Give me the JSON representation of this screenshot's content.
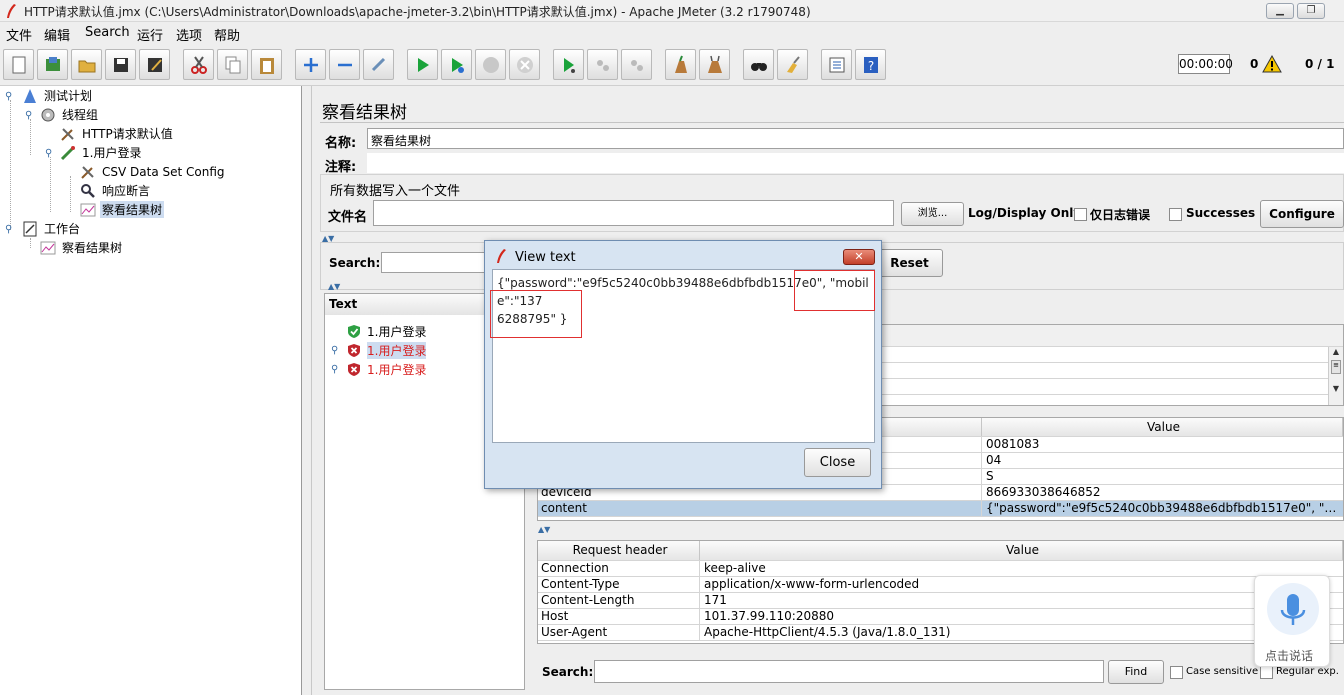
{
  "window": {
    "title": "HTTP请求默认值.jmx (C:\\Users\\Administrator\\Downloads\\apache-jmeter-3.2\\bin\\HTTP请求默认值.jmx) - Apache JMeter (3.2 r1790748)",
    "minimize": "▁",
    "maximize": "❐",
    "close": "✕"
  },
  "menu": [
    "文件",
    "编辑",
    "Search",
    "运行",
    "选项",
    "帮助"
  ],
  "status": {
    "timer": "00:00:00",
    "warnings": "0",
    "threads": "0 / 1"
  },
  "tree": {
    "nodes": [
      {
        "label": "测试计划",
        "icon": "test-plan-icon"
      },
      {
        "label": "线程组",
        "icon": "thread-group-icon"
      },
      {
        "label": "HTTP请求默认值",
        "icon": "config-tool-icon"
      },
      {
        "label": "1.用户登录",
        "icon": "sampler-icon"
      },
      {
        "label": "CSV Data Set Config",
        "icon": "config-tool-icon"
      },
      {
        "label": "响应断言",
        "icon": "assertion-icon"
      },
      {
        "label": "察看结果树",
        "icon": "listener-icon"
      },
      {
        "label": "工作台",
        "icon": "workbench-icon"
      },
      {
        "label": "察看结果树",
        "icon": "listener-icon"
      }
    ]
  },
  "panel": {
    "title": "察看结果树",
    "name_label": "名称:",
    "name_value": "察看结果树",
    "comment_label": "注释:",
    "file_section": "所有数据写入一个文件",
    "filename_label": "文件名",
    "browse": "浏览...",
    "log_display": "Log/Display Only:",
    "errors_only": "仅日志错误",
    "successes": "Successes",
    "configure": "Configure",
    "search_label": "Search:",
    "reset": "Reset",
    "text_header": "Text",
    "results": [
      {
        "label": "1.用户登录",
        "status": "success"
      },
      {
        "label": "1.用户登录",
        "status": "fail"
      },
      {
        "label": "1.用户登录",
        "status": "fail"
      }
    ],
    "params_header_value": "Value",
    "params": [
      {
        "name": "",
        "value": "0081083"
      },
      {
        "name": "",
        "value": "04"
      },
      {
        "name": "",
        "value": "S"
      },
      {
        "name": "deviceId",
        "value": "866933038646852"
      },
      {
        "name": "content",
        "value": "{\"password\":\"e9f5c5240c0bb39488e6dbfbdb1517e0\", \"mobile\":..."
      }
    ],
    "req_header_col": "Request header",
    "req_value_col": "Value",
    "req_headers": [
      {
        "name": "Connection",
        "value": "keep-alive"
      },
      {
        "name": "Content-Type",
        "value": "application/x-www-form-urlencoded"
      },
      {
        "name": "Content-Length",
        "value": "171"
      },
      {
        "name": "Host",
        "value": "101.37.99.110:20880"
      },
      {
        "name": "User-Agent",
        "value": "Apache-HttpClient/4.5.3 (Java/1.8.0_131)"
      }
    ],
    "bottom_search_label": "Search:",
    "find": "Find",
    "case_sensitive": "Case sensitive",
    "regular_exp": "Regular exp."
  },
  "dialog": {
    "title": "View text",
    "close_x": "✕",
    "text_line1": "{\"password\":\"e9f5c5240c0bb39488e6dbfbdb1517e0\", \"mobile\":\"137",
    "text_line2": "6288795\" }",
    "close_button": "Close"
  },
  "voice_widget": {
    "label": "点击说话"
  }
}
